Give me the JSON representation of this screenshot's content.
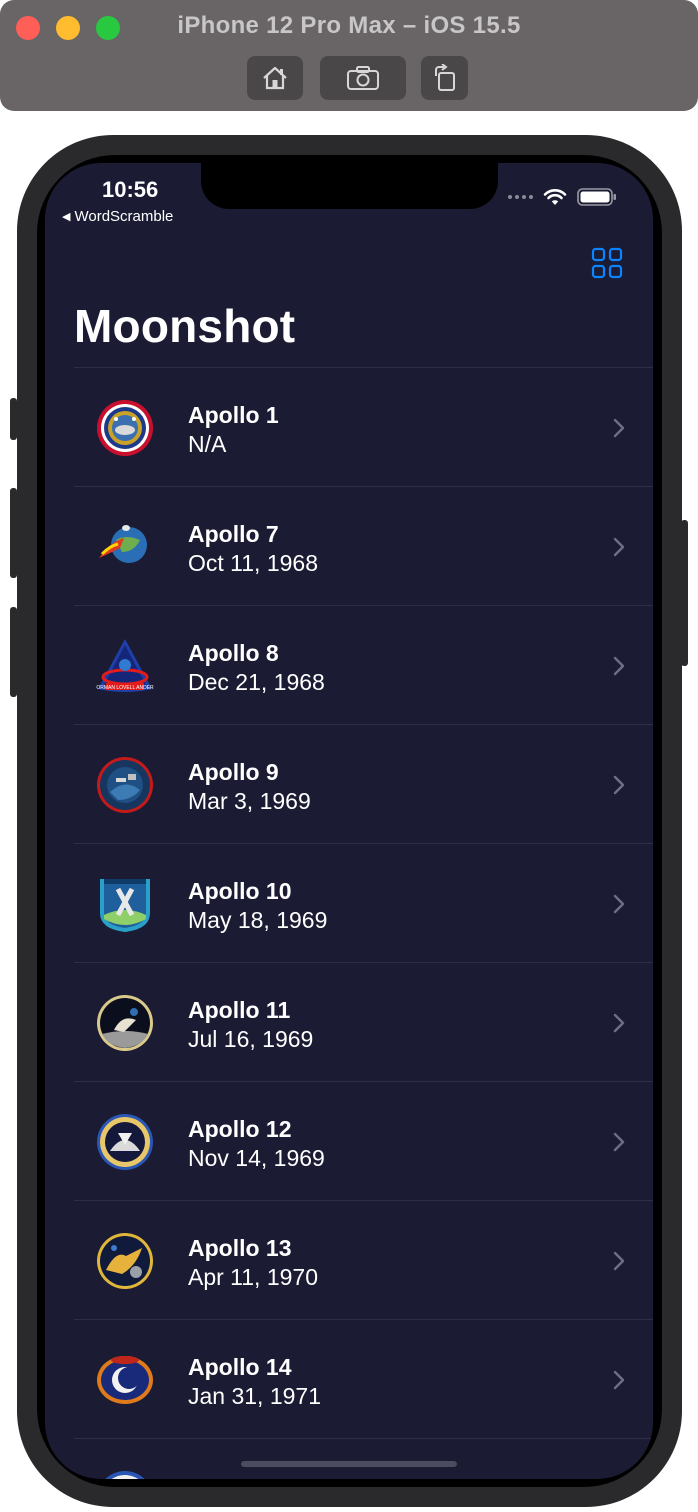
{
  "simulator": {
    "title": "iPhone 12 Pro Max – iOS 15.5"
  },
  "status_bar": {
    "time": "10:56",
    "back_app": "WordScramble"
  },
  "nav": {
    "title": "Moonshot",
    "layout_toggle_icon": "grid-icon",
    "accent_color": "#0a84ff"
  },
  "missions": [
    {
      "name": "Apollo 1",
      "date": "N/A"
    },
    {
      "name": "Apollo 7",
      "date": "Oct 11, 1968"
    },
    {
      "name": "Apollo 8",
      "date": "Dec 21, 1968"
    },
    {
      "name": "Apollo 9",
      "date": "Mar 3, 1969"
    },
    {
      "name": "Apollo 10",
      "date": "May 18, 1969"
    },
    {
      "name": "Apollo 11",
      "date": "Jul 16, 1969"
    },
    {
      "name": "Apollo 12",
      "date": "Nov 14, 1969"
    },
    {
      "name": "Apollo 13",
      "date": "Apr 11, 1970"
    },
    {
      "name": "Apollo 14",
      "date": "Jan 31, 1971"
    }
  ],
  "colors": {
    "background": "#1b1b33",
    "separator": "#2e2e47",
    "text": "#ffffff"
  }
}
